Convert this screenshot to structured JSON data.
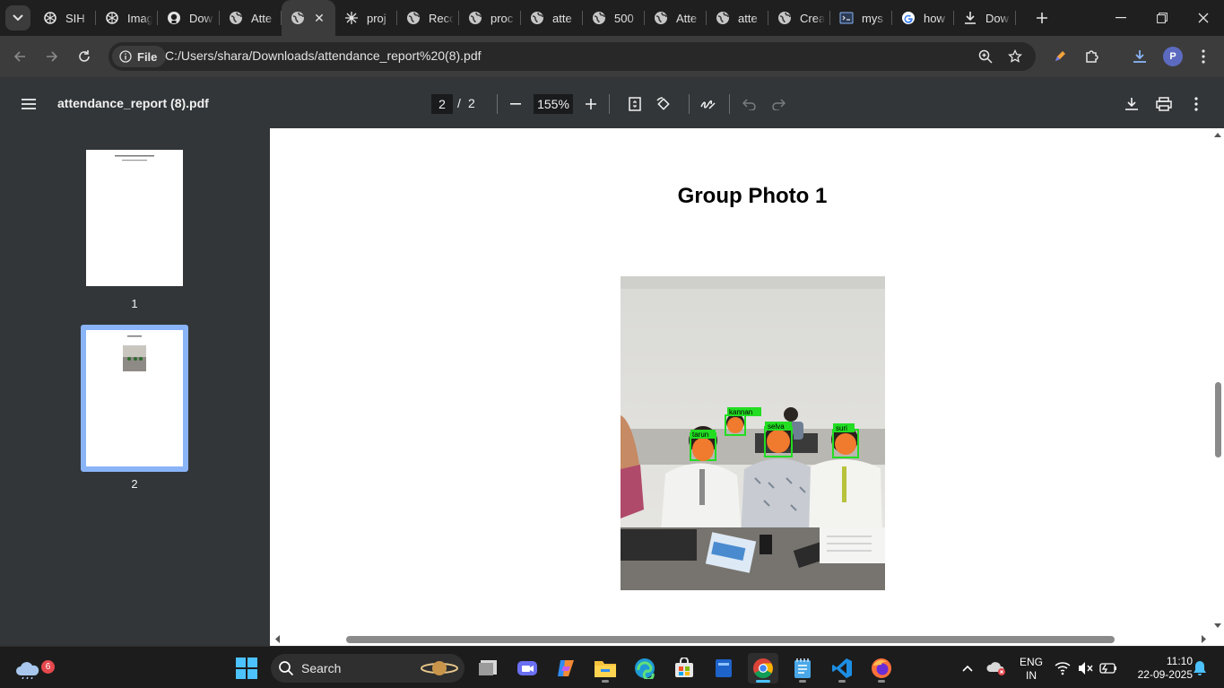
{
  "browser": {
    "tabs": [
      {
        "title": "SIH",
        "icon": "chatgpt-icon"
      },
      {
        "title": "Imag",
        "icon": "chatgpt-icon"
      },
      {
        "title": "Dow",
        "icon": "github-icon"
      },
      {
        "title": "Atte",
        "icon": "globe-icon"
      },
      {
        "title": "",
        "icon": "globe-icon",
        "active": true
      },
      {
        "title": "proj",
        "icon": "model-icon"
      },
      {
        "title": "Reco",
        "icon": "globe-icon"
      },
      {
        "title": "proc",
        "icon": "globe-icon"
      },
      {
        "title": "atte",
        "icon": "globe-icon"
      },
      {
        "title": "500",
        "icon": "globe-icon"
      },
      {
        "title": "Atte",
        "icon": "globe-icon"
      },
      {
        "title": "atte",
        "icon": "globe-icon"
      },
      {
        "title": "Crea",
        "icon": "globe-icon"
      },
      {
        "title": "mys",
        "icon": "terminal-icon"
      },
      {
        "title": "how",
        "icon": "google-icon"
      },
      {
        "title": "Dow",
        "icon": "download-icon"
      }
    ],
    "address": {
      "chip_label": "File",
      "url": "C:/Users/shara/Downloads/attendance_report%20(8).pdf"
    },
    "profile_initial": "P"
  },
  "pdf": {
    "filename": "attendance_report (8).pdf",
    "current_page": "2",
    "page_separator": "/",
    "total_pages": "2",
    "zoom": "155%",
    "thumbnails": [
      {
        "label": "1"
      },
      {
        "label": "2",
        "selected": true
      }
    ],
    "page_heading": "Group Photo 1",
    "face_labels": [
      "kannan",
      "tarun",
      "selva",
      "suri"
    ]
  },
  "taskbar": {
    "weather_badge": "6",
    "search_label": "Search",
    "language_top": "ENG",
    "language_bottom": "IN",
    "time": "11:10",
    "date": "22-09-2025"
  },
  "colors": {
    "accent": "#8ab4f8",
    "face_box": "#22dd22",
    "face_fill": "#f07a2e"
  }
}
